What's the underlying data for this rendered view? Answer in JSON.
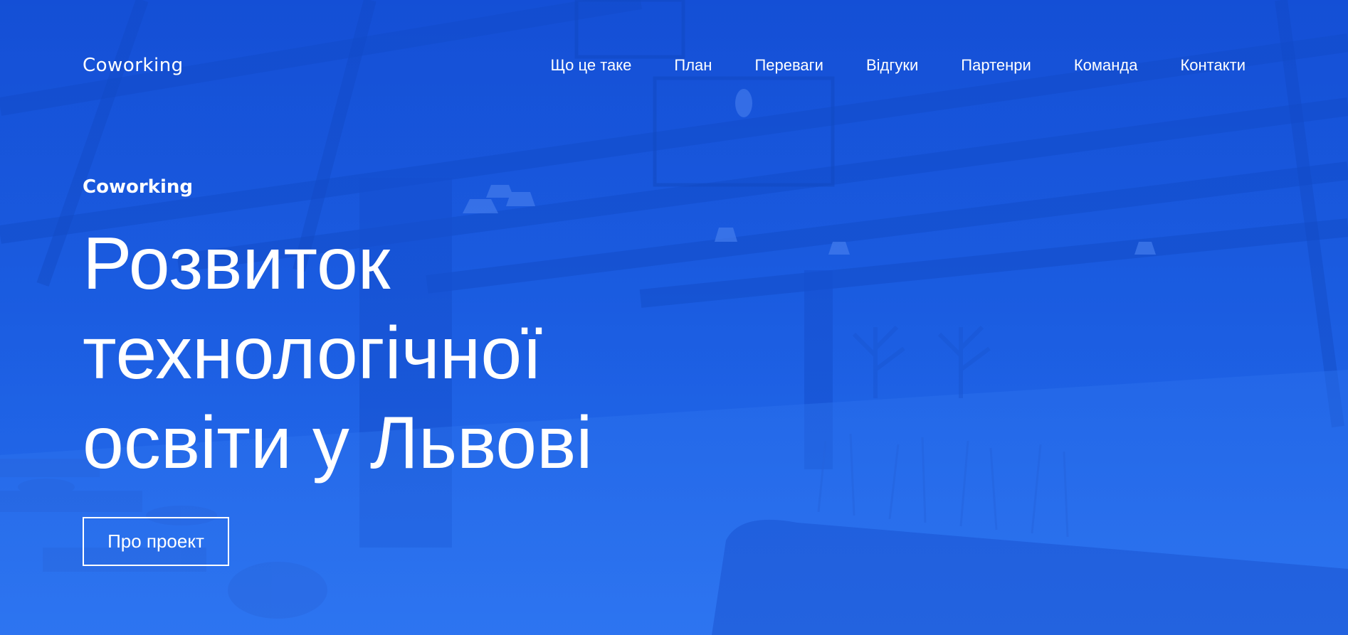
{
  "header": {
    "logo": "Coworking",
    "nav": [
      {
        "label": "Що це таке"
      },
      {
        "label": "План"
      },
      {
        "label": "Переваги"
      },
      {
        "label": "Відгуки"
      },
      {
        "label": "Партенри"
      },
      {
        "label": "Команда"
      },
      {
        "label": "Контакти"
      }
    ]
  },
  "hero": {
    "eyebrow": "Coworking",
    "headline": [
      "Розвиток",
      "технологічної",
      "освіти у Львові"
    ],
    "cta_label": "Про проект"
  },
  "colors": {
    "primary_overlay": "#1a5de0",
    "text": "#ffffff"
  }
}
